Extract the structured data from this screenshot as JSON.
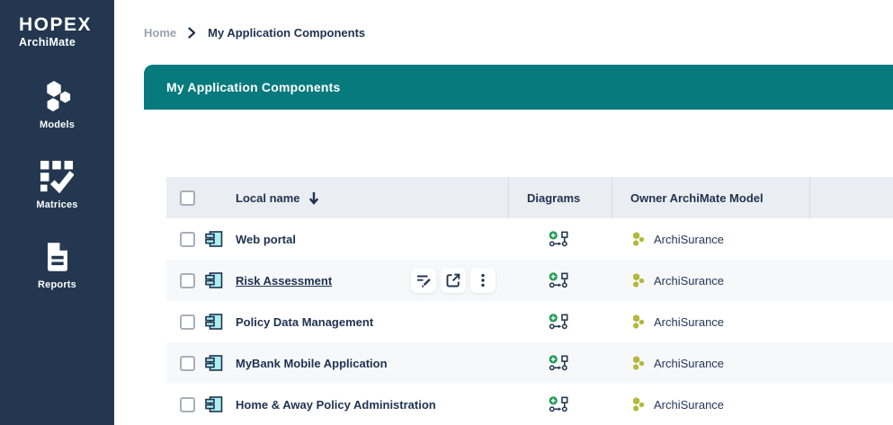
{
  "sidebar": {
    "logo": {
      "title": "HOPEX",
      "subtitle": "ArchiMate"
    },
    "items": [
      {
        "label": "Models",
        "icon": "hexagon-cluster-icon"
      },
      {
        "label": "Matrices",
        "icon": "grid-check-icon"
      },
      {
        "label": "Reports",
        "icon": "document-icon"
      }
    ]
  },
  "breadcrumb": {
    "home": "Home",
    "current": "My Application Components"
  },
  "panel": {
    "title": "My Application Components"
  },
  "table": {
    "headers": {
      "name": "Local name",
      "diagrams": "Diagrams",
      "owner": "Owner ArchiMate Model"
    },
    "sort": {
      "column": "Local name",
      "direction": "descending"
    },
    "rows": [
      {
        "name": "Web portal",
        "owner": "ArchiSurance"
      },
      {
        "name": "Risk Assessment",
        "owner": "ArchiSurance",
        "hovered": true
      },
      {
        "name": "Policy Data Management",
        "owner": "ArchiSurance"
      },
      {
        "name": "MyBank Mobile Application",
        "owner": "ArchiSurance"
      },
      {
        "name": "Home & Away Policy Administration",
        "owner": "ArchiSurance"
      }
    ],
    "row_actions": [
      "edit",
      "open",
      "more"
    ]
  },
  "icons": {
    "row_type": "application-component-icon",
    "diagrams_cell": "diagram-graph-icon",
    "owner_cell": "hexagon-cluster-icon"
  },
  "colors": {
    "sidebar_bg": "#233750",
    "panel_teal": "#077A7D",
    "navy_text": "#1E3250",
    "header_row_bg": "#EAEDF1",
    "stripe_row_bg": "#F7F8FA",
    "owner_olive": "#B4B83A",
    "diagram_green": "#1F9D55",
    "component_cyan": "#AEEFEF",
    "breadcrumb_muted": "#9AA2AE"
  }
}
